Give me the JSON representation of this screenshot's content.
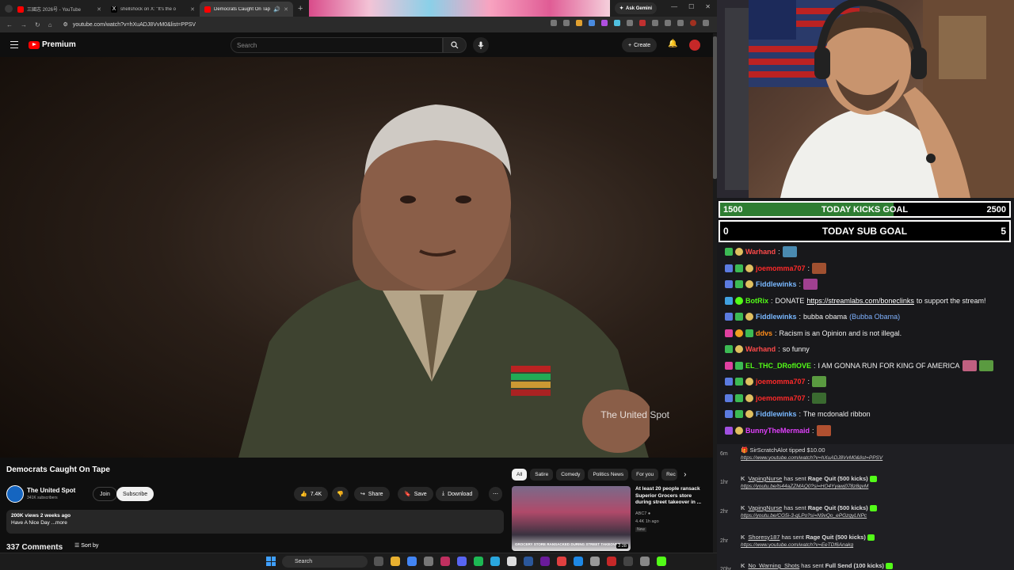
{
  "browser": {
    "tabs": [
      {
        "title": "三國志 2026号 - YouTube",
        "color": "#ff0000"
      },
      {
        "title": "shellshock on X: \"It's the o",
        "color": "#333333"
      },
      {
        "title": "Democrats Caught On Tap",
        "color": "#ff0000"
      }
    ],
    "ask_gemini": "Ask Gemini",
    "url": "youtube.com/watch?v=hXuADJ8VvM0&list=PPSV"
  },
  "youtube": {
    "logo": "Premium",
    "search_placeholder": "Search",
    "create_label": "Create",
    "video": {
      "watermark": "The United Spot",
      "title": "Democrats Caught On Tape"
    },
    "channel": {
      "name": "The United Spot",
      "subscribers": "341K subscribers",
      "join": "Join",
      "subscribe": "Subscribe"
    },
    "actions": {
      "likes": "7.4K",
      "share": "Share",
      "save": "Save",
      "download": "Download"
    },
    "description": {
      "stats": "200K views  2 weeks ago",
      "text": "Have A Nice Day ...more"
    },
    "comments": {
      "count": "337 Comments",
      "sort": "Sort by"
    },
    "chips": [
      "All",
      "Satire",
      "Comedy",
      "Politics News",
      "For you",
      "Rec"
    ],
    "recommendation": {
      "title": "At least 20 people ransack Superior Grocers store during street takeover in ...",
      "channel": "ABC7",
      "meta": "4.4K  1h ago",
      "badge": "New",
      "duration": "2:28",
      "thumb_caption": "GROCERY STORE RANSACKED DURING STREET TAKEOVER"
    }
  },
  "taskbar": {
    "search": "Search"
  },
  "stream": {
    "kicks_goal": {
      "current": "1500",
      "label": "TODAY KICKS GOAL",
      "target": "2500",
      "progress": 0.6
    },
    "sub_goal": {
      "current": "0",
      "label": "TODAY SUB GOAL",
      "target": "5"
    },
    "chat": [
      {
        "user": "Warhand",
        "color": "#ff4a4a",
        "text": ""
      },
      {
        "user": "joemomma707",
        "color": "#ff2a2a",
        "text": ""
      },
      {
        "user": "Fiddlewinks",
        "color": "#79b8ff",
        "text": ""
      },
      {
        "user": "BotRix",
        "color": "#53fc18",
        "text": "DONATE ",
        "link": "https://streamlabs.com/boneclinks",
        "tail": " to support the stream!"
      },
      {
        "user": "Fiddlewinks",
        "color": "#79b8ff",
        "text": "bubba obama ",
        "extra": "(Bubba Obama)"
      },
      {
        "user": "ddvs",
        "color": "#ff8c1a",
        "text": "Racism is an Opinion and is not illegal."
      },
      {
        "user": "Warhand",
        "color": "#ff4a4a",
        "text": "so funny"
      },
      {
        "user": "EL_THC_DRoflOVE",
        "color": "#53fc18",
        "text": "I AM GONNA RUN FOR KING OF AMERICA"
      },
      {
        "user": "joemomma707",
        "color": "#ff2a2a",
        "text": ""
      },
      {
        "user": "joemomma707",
        "color": "#ff2a2a",
        "text": ""
      },
      {
        "user": "Fiddlewinks",
        "color": "#79b8ff",
        "text": "The mcdonald ribbon"
      },
      {
        "user": "BunnyTheMermaid",
        "color": "#e040fb",
        "text": ""
      }
    ],
    "events": [
      {
        "age": "6m",
        "line1": "SirScratchAlot tipped $10.00",
        "line2": "https://www.youtube.com/watch?v=hXuADJ8VvM0&list=PPSV"
      },
      {
        "age": "1hr",
        "name": "VapingNurse",
        "action": " has sent ",
        "gift": "Rage Quit (500 kicks)",
        "line2": "https://youtu.be/ts44aZZMAQ0?si=HO4Yyawj078z8gvM"
      },
      {
        "age": "2hr",
        "name": "VapingNurse",
        "action": " has sent ",
        "gift": "Rage Quit (500 kicks)",
        "line2": "https://youtu.be/CG5i-3-qLPo?si=N9vQo_ePGzqyLNPc"
      },
      {
        "age": "2hr",
        "name": "Shoresy187",
        "action": " has sent ",
        "gift": "Rage Quit (500 kicks)",
        "line2": "https://www.youtube.com/watch?v=EeTDf6Anakg"
      },
      {
        "age": "20hr",
        "name": "No_Warning_Shots",
        "action": " has sent ",
        "gift": "Full Send (100 kicks)",
        "line2": ""
      }
    ]
  }
}
